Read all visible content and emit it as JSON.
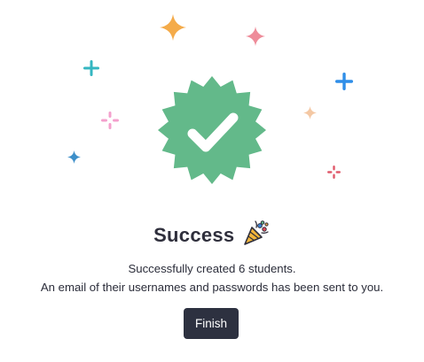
{
  "dialog": {
    "title": "Success",
    "message_line1": "Successfully created 6 students.",
    "message_line2": "An email of their usernames and passwords has been sent to you.",
    "finish_label": "Finish"
  },
  "icons": {
    "badge": "verified-check-badge-icon",
    "celebration": "party-popper-icon",
    "decorations": "sparkle-icon"
  },
  "colors": {
    "badge_green": "#63b98a",
    "button_dark": "#2d3140",
    "sparkle_orange": "#f4ab4a",
    "sparkle_pink": "#ee8c9a",
    "sparkle_teal": "#34b6c1",
    "sparkle_blue": "#2f8ee8",
    "sparkle_light_pink": "#f4a0cd",
    "sparkle_peach": "#f4c8a4",
    "sparkle_steel_blue": "#3d8fc9",
    "sparkle_red": "#e0596a"
  }
}
